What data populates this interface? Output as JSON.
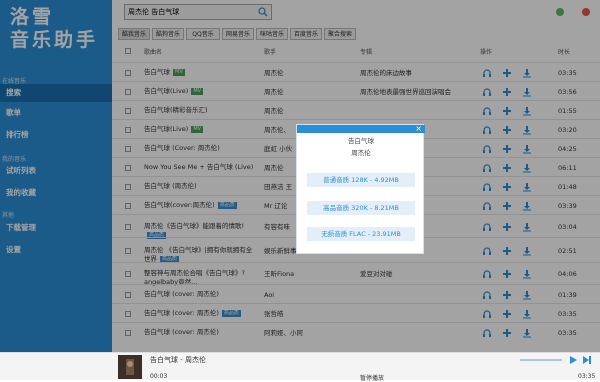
{
  "app": {
    "logo_line1": "洛雪",
    "logo_line2": "音乐助手"
  },
  "sidebar": {
    "sections": [
      {
        "title": "在线音乐",
        "items": [
          {
            "label": "搜索",
            "active": true
          },
          {
            "label": "歌单"
          },
          {
            "label": "排行榜"
          }
        ]
      },
      {
        "title": "我的音乐",
        "items": [
          {
            "label": "试听列表"
          },
          {
            "label": "我的收藏"
          }
        ]
      },
      {
        "title": "其他",
        "items": [
          {
            "label": "下载管理"
          },
          {
            "label": "设置"
          }
        ]
      }
    ]
  },
  "search": {
    "value": "周杰伦 告白气球"
  },
  "tabs": [
    {
      "label": "酷我音乐",
      "active": true
    },
    {
      "label": "酷狗音乐"
    },
    {
      "label": "QQ音乐"
    },
    {
      "label": "网易音乐"
    },
    {
      "label": "咪咕音乐"
    },
    {
      "label": "百度音乐"
    },
    {
      "label": "聚合搜索"
    }
  ],
  "table": {
    "headers": {
      "name": "歌曲名",
      "artist": "歌手",
      "album": "专辑",
      "actions": "操作",
      "duration": "时长"
    },
    "rows": [
      {
        "name": "告白气球",
        "badge": "MV",
        "artist": "周杰伦",
        "album": "周杰伦的床边故事",
        "duration": "03:35"
      },
      {
        "name": "告白气球(Live)",
        "badge": "MV",
        "artist": "周杰伦",
        "album": "周杰伦地表最强世界巡回演唱会",
        "duration": "03:56"
      },
      {
        "name": "告白气球(精彩音乐汇)",
        "artist": "周杰伦",
        "album": "",
        "duration": "01:55"
      },
      {
        "name": "告白气球(Live)",
        "badge": "MV",
        "artist": "周杰伦、",
        "album": "会",
        "duration": "03:20"
      },
      {
        "name": "告白气球 (Cover: 周杰伦)",
        "artist": "庭虹 小伙",
        "album": "",
        "duration": "04:25"
      },
      {
        "name": "Now You See Me + 告白气球 (Live)",
        "artist": "周杰伦",
        "album": "",
        "duration": "06:11"
      },
      {
        "name": "告白气球 (周杰伦)",
        "artist": "田燕洁 王",
        "album": "",
        "duration": "01:48"
      },
      {
        "name": "告白气球(cover:周杰伦)",
        "badge2": "高品质",
        "artist": "Mr 辽论",
        "album": "",
        "duration": "03:39"
      },
      {
        "name": "周杰伦《告白气球》能跟着的情歌!",
        "badge2": "高品质",
        "artist": "有容有味",
        "album": "",
        "duration": "03:04"
      },
      {
        "name": "周杰伦 《告白气球》|拥有你就拥有全世界",
        "badge2": "高品质",
        "artist": "娱乐新鲜事",
        "album": "",
        "duration": "02:51"
      },
      {
        "name": "整容神与周杰伦合唱《告白气球》? angelbaby竟然...",
        "artist": "王昕Fiona",
        "album": "爱豆对对碰",
        "duration": "04:06"
      },
      {
        "name": "告白气球 (cover: 周杰伦)",
        "artist": "Aoi",
        "album": "",
        "duration": "01:39"
      },
      {
        "name": "告白气球 (cover: 周杰伦)",
        "badge2": "高品质",
        "artist": "张哲皓",
        "album": "",
        "duration": "03:35"
      },
      {
        "name": "告白气球 (cover: 周杰伦)",
        "artist": "阿莉娅、小阿",
        "album": "",
        "duration": "03:35"
      }
    ]
  },
  "modal": {
    "title": "告白气球",
    "subtitle": "周杰伦",
    "options": [
      "普通音质 128K - 4.92MB",
      "高品音质 320K - 8.21MB",
      "无损音质 FLAC - 23.91MB"
    ]
  },
  "player": {
    "title": "告白气球 - 周杰伦",
    "current_time": "00:03",
    "status": "暂停播放",
    "total_time": "03:35"
  }
}
